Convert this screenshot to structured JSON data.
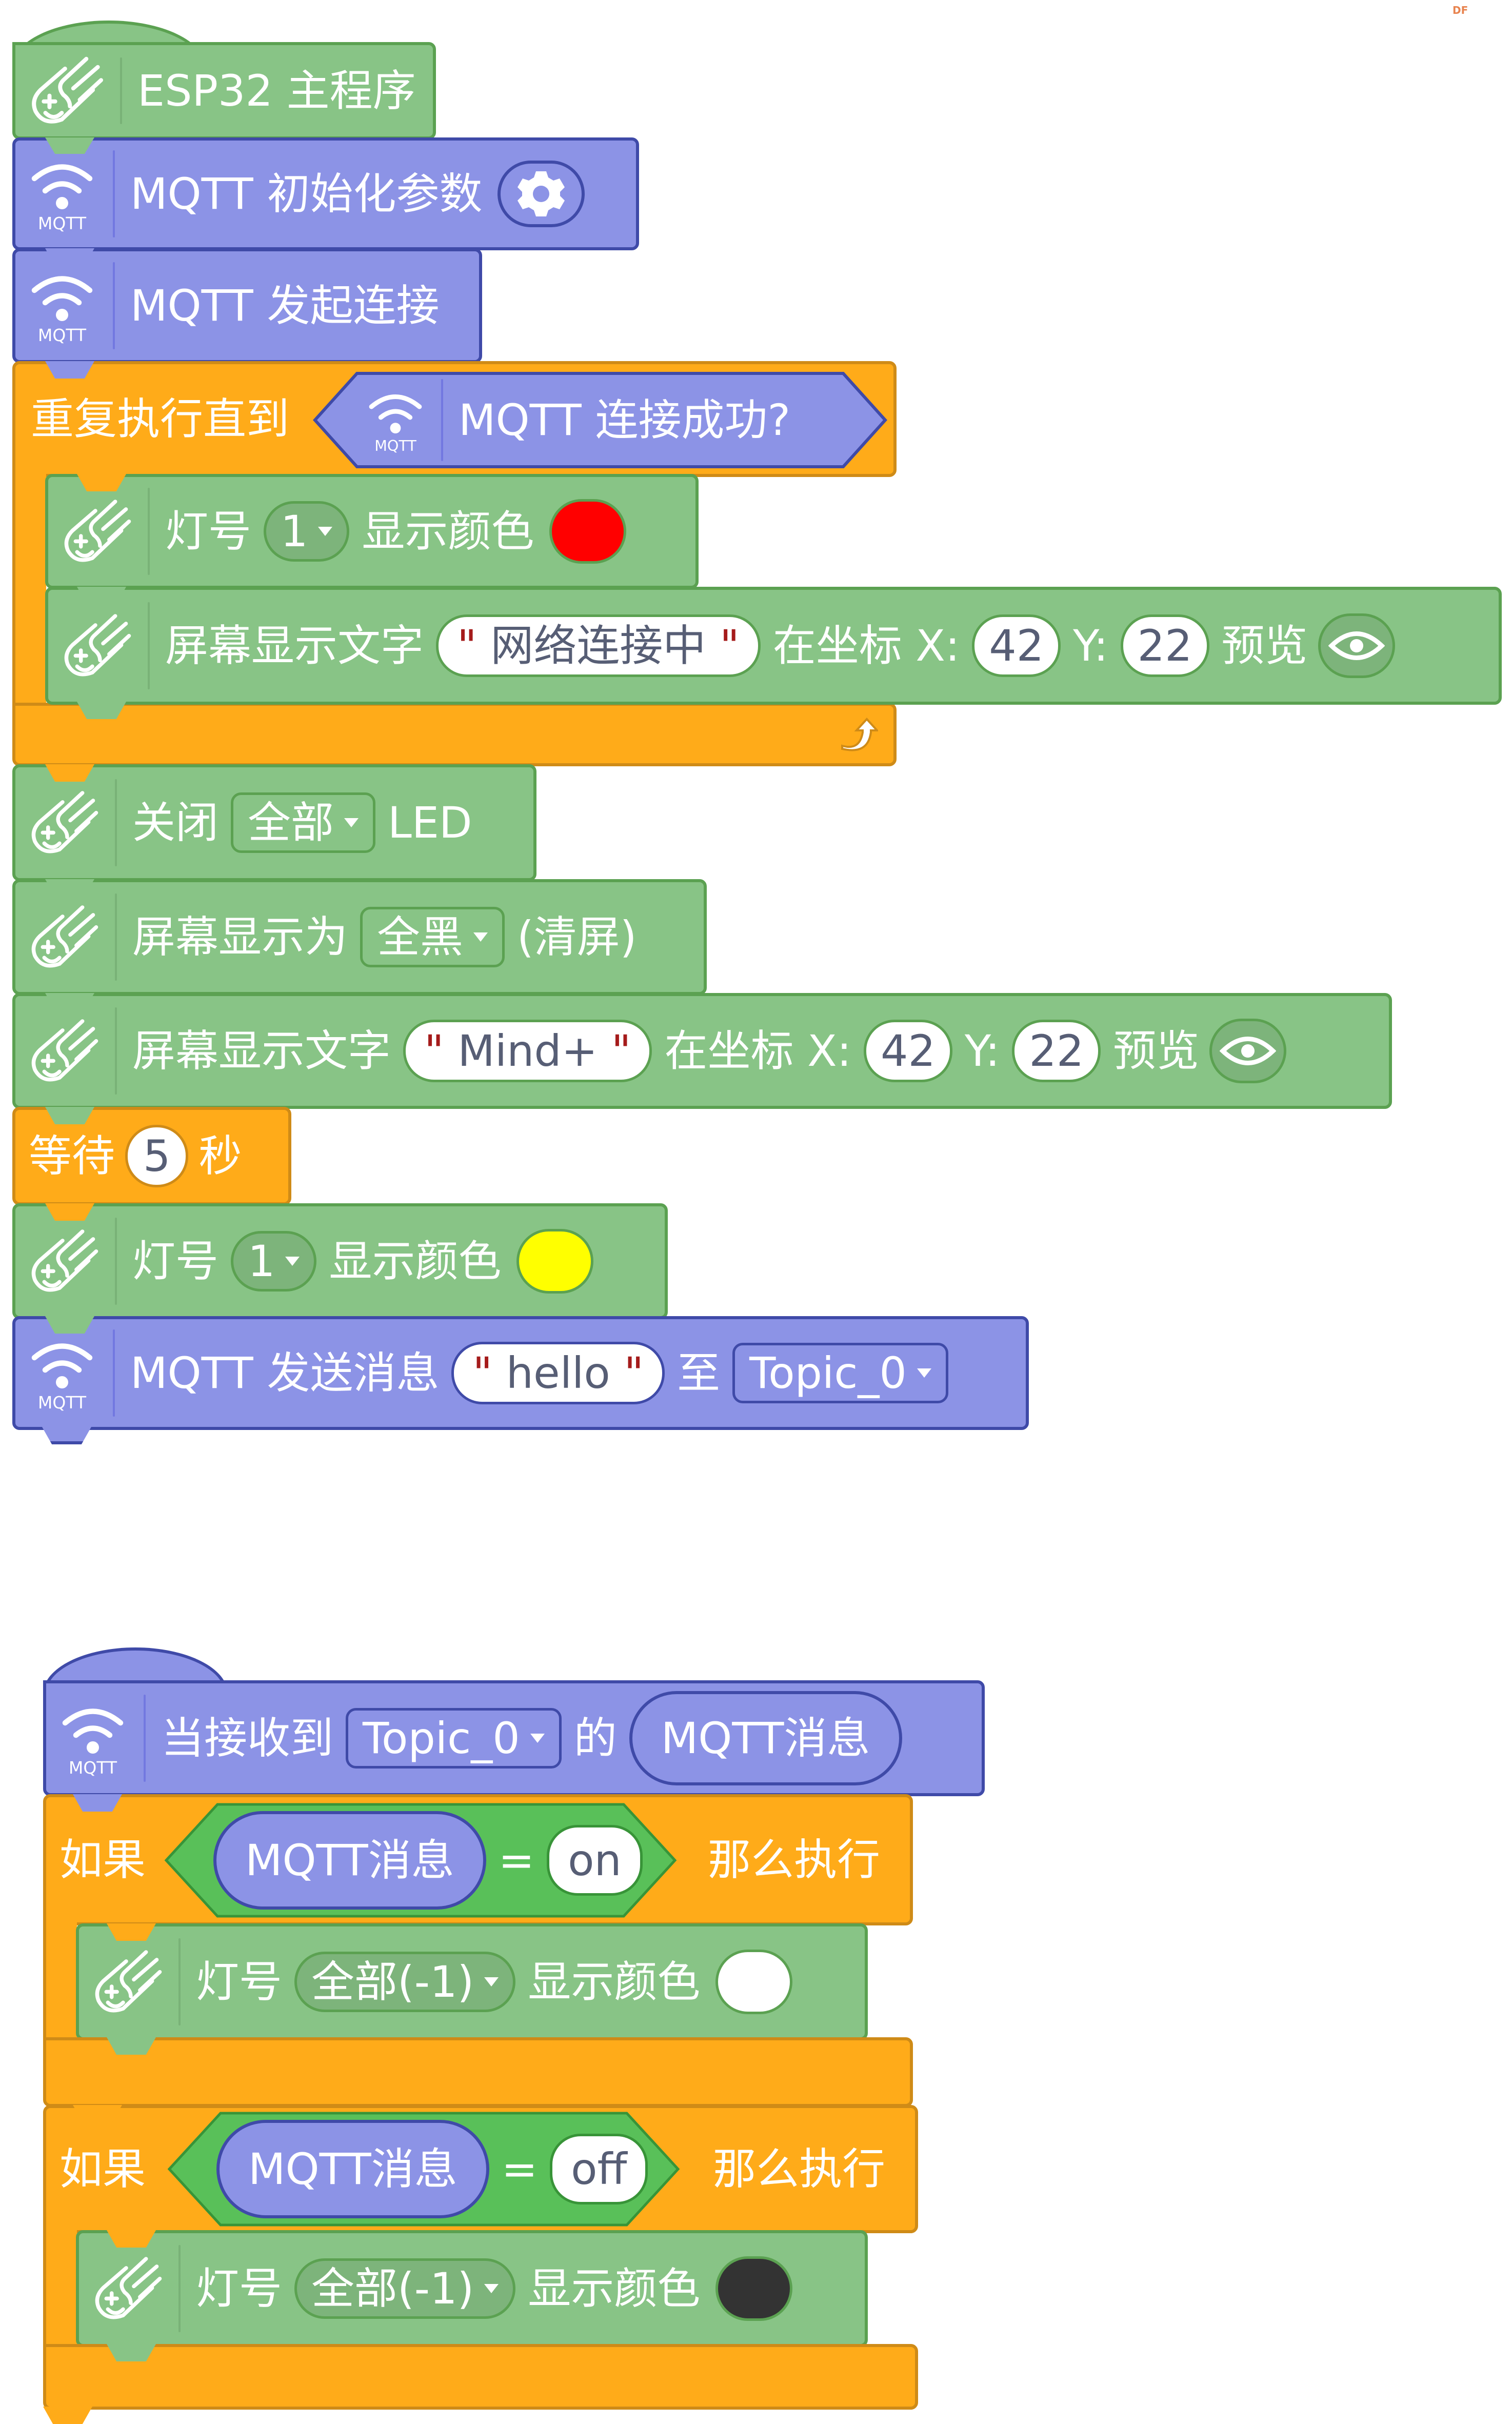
{
  "watermark": "DF",
  "colors": {
    "looks_green": "#88c486",
    "mqtt_purple": "#8c93e6",
    "control_orange": "#ffab19",
    "operator_green": "#59c059",
    "led_red": "#ff0000",
    "led_yellow": "#ffff00",
    "led_white": "#ffffff",
    "led_black": "#333333"
  },
  "script_main": {
    "hat": {
      "icon": "esp32-board-icon",
      "label": "ESP32 主程序"
    },
    "mqtt_init": {
      "icon": "mqtt-wifi-icon",
      "icon_text": "MQTT",
      "label": "MQTT 初始化参数",
      "settings_icon": "gear-icon"
    },
    "mqtt_connect": {
      "icon": "mqtt-wifi-icon",
      "icon_text": "MQTT",
      "label": "MQTT 发起连接"
    },
    "repeat_until": {
      "label": "重复执行直到",
      "condition": {
        "icon": "mqtt-wifi-icon",
        "icon_text": "MQTT",
        "label": "MQTT 连接成功?"
      },
      "loop_icon": "loop-arrow-icon",
      "body": [
        {
          "type": "led_color",
          "label_prefix": "灯号",
          "led": "1",
          "label_suffix": "显示颜色",
          "color": "#ff0000"
        },
        {
          "type": "screen_text",
          "label_prefix": "屏幕显示文字",
          "text": "网络连接中",
          "coord_label": "在坐标 X:",
          "x": "42",
          "y_label": "Y:",
          "y": "22",
          "preview_label": "预览",
          "preview_icon": "eye-icon"
        }
      ]
    },
    "led_off": {
      "label_prefix": "关闭",
      "target": "全部",
      "label_suffix": "LED"
    },
    "screen_fill": {
      "label_prefix": "屏幕显示为",
      "fill": "全黑",
      "label_suffix": "(清屏)"
    },
    "screen_text": {
      "label_prefix": "屏幕显示文字",
      "text": "Mind+",
      "coord_label": "在坐标 X:",
      "x": "42",
      "y_label": "Y:",
      "y": "22",
      "preview_label": "预览",
      "preview_icon": "eye-icon"
    },
    "wait": {
      "label_prefix": "等待",
      "seconds": "5",
      "label_suffix": "秒"
    },
    "led_color": {
      "label_prefix": "灯号",
      "led": "1",
      "label_suffix": "显示颜色",
      "color": "#ffff00"
    },
    "mqtt_send": {
      "icon": "mqtt-wifi-icon",
      "icon_text": "MQTT",
      "label": "MQTT 发送消息",
      "message": "hello",
      "to_label": "至",
      "topic": "Topic_0"
    }
  },
  "script_receive": {
    "hat": {
      "icon": "mqtt-wifi-icon",
      "icon_text": "MQTT",
      "label": "当接收到",
      "topic": "Topic_0",
      "of_label": "的",
      "reporter": "MQTT消息"
    },
    "if_blocks": [
      {
        "if_label": "如果",
        "left": "MQTT消息",
        "operator": "=",
        "right": "on",
        "then_label": "那么执行",
        "body": {
          "label_prefix": "灯号",
          "led": "全部(-1)",
          "label_suffix": "显示颜色",
          "color": "#ffffff"
        }
      },
      {
        "if_label": "如果",
        "left": "MQTT消息",
        "operator": "=",
        "right": "off",
        "then_label": "那么执行",
        "body": {
          "label_prefix": "灯号",
          "led": "全部(-1)",
          "label_suffix": "显示颜色",
          "color": "#333333"
        }
      }
    ]
  }
}
